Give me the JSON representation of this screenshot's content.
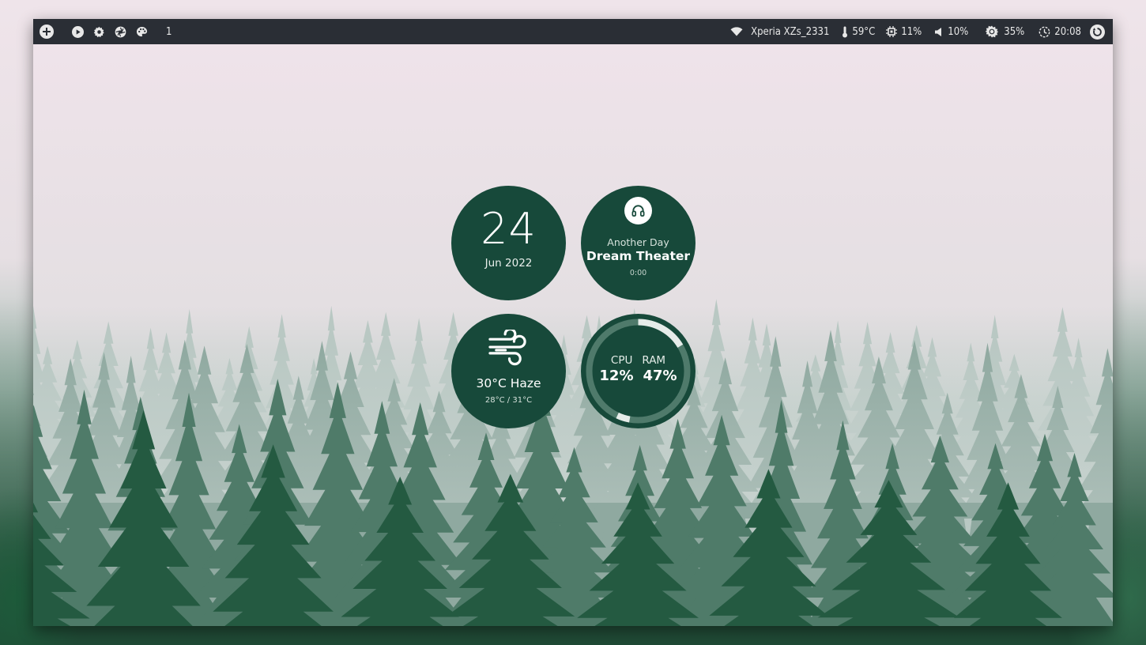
{
  "topbar": {
    "left_icons": [
      "plus-icon",
      "play-icon",
      "gear-icon",
      "aperture-icon",
      "palette-icon"
    ],
    "workspace": "1",
    "wifi_name": "Xperia XZs_2331",
    "temperature": "59°C",
    "cpu": "11%",
    "volume": "10%",
    "brightness": "35%",
    "clock": "20:08",
    "right_icons": [
      "wifi-icon",
      "thermometer-icon",
      "chip-icon",
      "speaker-icon",
      "brightness-icon",
      "clock-icon",
      "power-icon"
    ]
  },
  "widgets": {
    "date": {
      "day": "24",
      "month_year": "Jun 2022"
    },
    "music": {
      "icon": "headphones-icon",
      "song": "Another Day",
      "artist": "Dream Theater",
      "time": "0:00"
    },
    "weather": {
      "icon": "wind-icon",
      "current": "30°C Haze",
      "range": "28°C / 31°C"
    },
    "resources": {
      "cpu_label": "CPU",
      "ram_label": "RAM",
      "cpu_value": "12%",
      "ram_value": "47%",
      "cpu_fraction": 0.12,
      "ram_fraction": 0.47
    }
  },
  "colors": {
    "widget_bg": "#17493a",
    "topbar_bg": "#2a2e35",
    "ring_track": "#4f7a6b",
    "ring_fill": "#e6ece9"
  }
}
